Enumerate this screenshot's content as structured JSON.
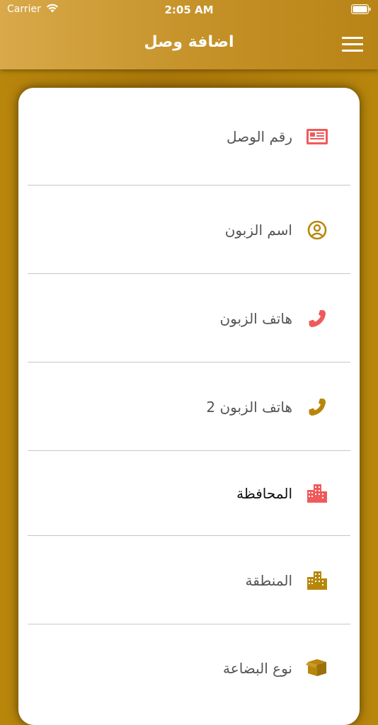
{
  "status_bar": {
    "carrier": "Carrier",
    "time": "2:05 AM"
  },
  "header": {
    "title": "اضافة وصل",
    "menu_icon": "hamburger-menu-icon"
  },
  "colors": {
    "gold": "#b8860b",
    "red": "#f05a5a",
    "label": "#555555"
  },
  "form": {
    "fields": [
      {
        "label": "رقم الوصل",
        "icon": "receipt-icon"
      },
      {
        "label": "اسم الزبون",
        "icon": "user-circle-icon"
      },
      {
        "label": "هاتف الزبون",
        "icon": "phone-icon"
      },
      {
        "label": "هاتف الزبون 2",
        "icon": "phone-icon"
      },
      {
        "label": "المحافظة",
        "icon": "city-icon"
      },
      {
        "label": "المنطقة",
        "icon": "city-icon"
      },
      {
        "label": "نوع البضاعة",
        "icon": "box-icon"
      }
    ]
  }
}
